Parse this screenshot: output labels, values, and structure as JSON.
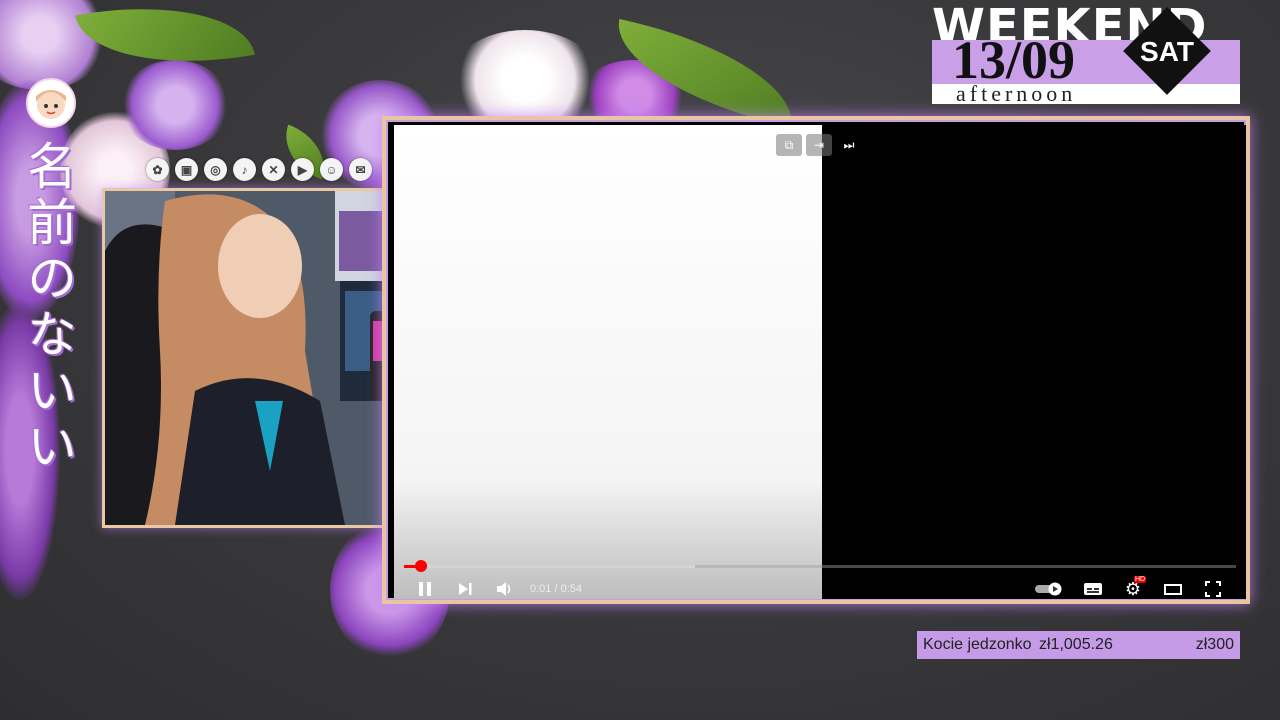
{
  "overlay": {
    "channel_title_jp": "名前のないい",
    "weekend": {
      "word": "WEEKEND",
      "date": "13/09",
      "day": "SAT",
      "period": "afternoon"
    },
    "social_icons": [
      "linktree-icon",
      "twitch-icon",
      "instagram-icon",
      "tiktok-icon",
      "x-icon",
      "youtube-icon",
      "discord-icon",
      "gmail-icon"
    ],
    "goal": {
      "name": "Kocie jedzonko",
      "amount": "zł1,005.26",
      "target": "zł300"
    },
    "accent_color": "#c59ae6",
    "frame_color": "#e8c6a0"
  },
  "player": {
    "time": "0:01 / 0:54",
    "progress_fraction": 0.02,
    "buffered_fraction": 0.35
  }
}
